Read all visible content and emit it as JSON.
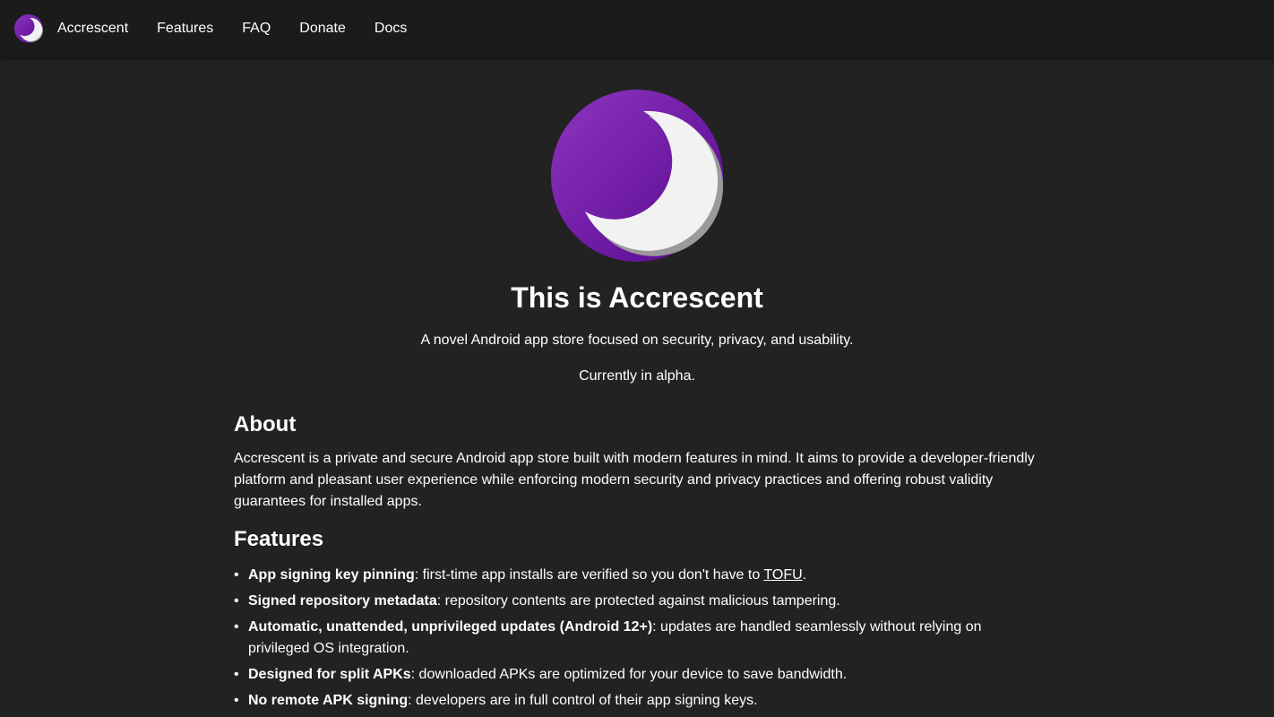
{
  "nav": {
    "brand": "Accrescent",
    "items": [
      "Features",
      "FAQ",
      "Donate",
      "Docs"
    ]
  },
  "hero": {
    "title": "This is Accrescent",
    "tagline": "A novel Android app store focused on security, privacy, and usability.",
    "status": "Currently in alpha."
  },
  "about": {
    "heading": "About",
    "text": "Accrescent is a private and secure Android app store built with modern features in mind. It aims to provide a developer-friendly platform and pleasant user experience while enforcing modern security and privacy practices and offering robust validity guarantees for installed apps."
  },
  "features": {
    "heading": "Features",
    "bullet": "•",
    "items": [
      {
        "title": "App signing key pinning",
        "sep": ": ",
        "text": "first-time app installs are verified so you don't have to ",
        "link": "TOFU",
        "after": "."
      },
      {
        "title": "Signed repository metadata",
        "sep": ": ",
        "text": "repository contents are protected against malicious tampering."
      },
      {
        "title": "Automatic, unattended, unprivileged updates (Android 12+)",
        "sep": ": ",
        "text": "updates are handled seamlessly without relying on privileged OS integration."
      },
      {
        "title": "Designed for split APKs",
        "sep": ": ",
        "text": "downloaded APKs are optimized for your device to save bandwidth."
      },
      {
        "title": "No remote APK signing",
        "sep": ": ",
        "text": "developers are in full control of their app signing keys."
      }
    ]
  },
  "icons": {
    "logo": "crescent-moon-logo-icon"
  },
  "colors": {
    "background": "#222222",
    "topbar": "#1b1b1b",
    "logo_purple": "#7a1fb0",
    "logo_purple_dark": "#5b0a96",
    "moon_white": "#f2f2f2",
    "text": "#ffffff"
  }
}
